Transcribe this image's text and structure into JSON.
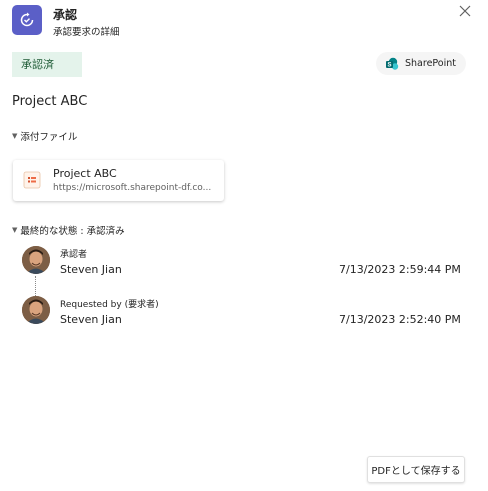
{
  "header": {
    "app_icon": "approvals-refresh-icon",
    "title": "承認",
    "subtitle": "承認要求の詳細",
    "close_icon": "close-icon"
  },
  "status": {
    "label": "承認済",
    "color": "#1e5b36",
    "background": "#e4f3eb"
  },
  "sharepoint_button": {
    "label": "SharePoint",
    "icon": "sharepoint-icon",
    "brand_color": "#038387"
  },
  "request": {
    "title": "Project ABC"
  },
  "attachments": {
    "header": "添付ファイル",
    "items": [
      {
        "name": "Project ABC",
        "url": "https://microsoft.sharepoint-df.co...",
        "icon": "file-icon"
      }
    ]
  },
  "final_status": {
    "header": "最終的な状態 : 承認済み",
    "entries": [
      {
        "role": "承認者",
        "name": "Steven Jian",
        "timestamp": "7/13/2023 2:59:44 PM"
      },
      {
        "role": "Requested by (要求者)",
        "name": "Steven Jian",
        "timestamp": "7/13/2023 2:52:40 PM"
      }
    ]
  },
  "footer": {
    "pdf_button": "PDFとして保存する"
  },
  "colors": {
    "accent": "#5b5fc7"
  }
}
